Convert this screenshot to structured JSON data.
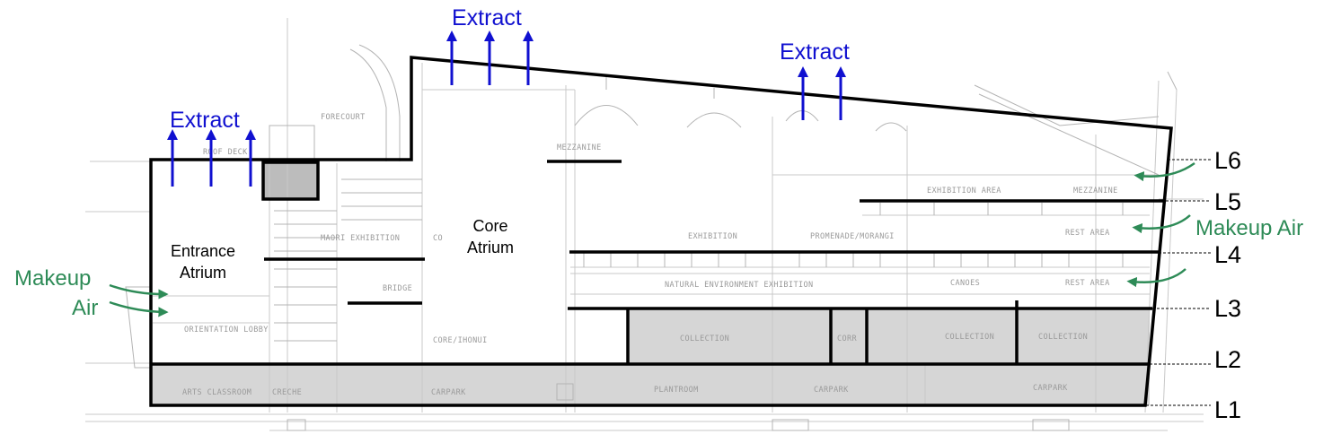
{
  "colors": {
    "extract": "#1010d0",
    "makeup": "#2e8b57",
    "outline": "#000000",
    "shaded": "#d2d2d2",
    "faint_plan": "#c8c8c8"
  },
  "extract_labels": [
    "Extract",
    "Extract",
    "Extract"
  ],
  "makeup_left": {
    "line1": "Makeup",
    "line2": "Air"
  },
  "makeup_right": "Makeup Air",
  "spaces": {
    "entrance_atrium": {
      "line1": "Entrance",
      "line2": "Atrium"
    },
    "core_atrium": {
      "line1": "Core",
      "line2": "Atrium"
    }
  },
  "levels": [
    "L6",
    "L5",
    "L4",
    "L3",
    "L2",
    "L1"
  ],
  "plan_labels": {
    "forecourt": "FORECOURT",
    "roof_deck": "ROOF DECK",
    "mezzanine_1": "MEZZANINE",
    "mezzanine_2": "MEZZANINE",
    "exhibition_area": "EXHIBITION AREA",
    "maori_exhibition": "MAORI EXHIBITION",
    "co": "CO",
    "exhibition": "EXHIBITION",
    "promenade": "PROMENADE/MORANGI",
    "rest_area_1": "REST AREA",
    "rest_area_2": "REST AREA",
    "natural_env": "NATURAL ENVIRONMENT EXHIBITION",
    "canoes": "CANOES",
    "bridge": "BRIDGE",
    "orientation_lobby": "ORIENTATION LOBBY",
    "core_ihonui": "CORE/IHONUI",
    "collection_1": "COLLECTION",
    "corr": "CORR",
    "collection_2": "COLLECTION",
    "collection_3": "COLLECTION",
    "arts_classroom": "ARTS CLASSROOM",
    "creche": "CRECHE",
    "carpark_1": "CARPARK",
    "plantroom": "PLANTROOM",
    "carpark_2": "CARPARK",
    "carpark_3": "CARPARK"
  }
}
